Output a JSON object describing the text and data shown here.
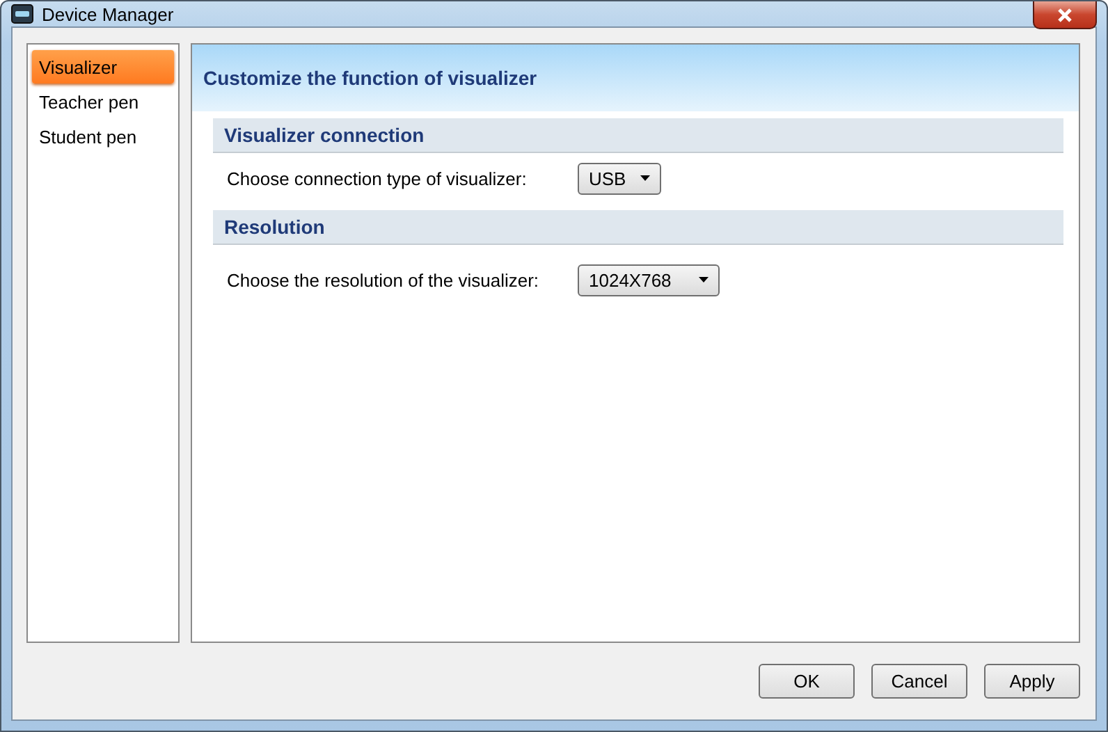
{
  "window": {
    "title": "Device Manager"
  },
  "sidebar": {
    "items": [
      {
        "label": "Visualizer",
        "selected": true
      },
      {
        "label": "Teacher pen",
        "selected": false
      },
      {
        "label": "Student pen",
        "selected": false
      }
    ]
  },
  "panel": {
    "title": "Customize the function of visualizer",
    "sections": [
      {
        "title": "Visualizer connection",
        "label": "Choose connection type of visualizer:",
        "value": "USB"
      },
      {
        "title": "Resolution",
        "label": "Choose the resolution of the visualizer:",
        "value": "1024X768"
      }
    ]
  },
  "buttons": [
    "OK",
    "Cancel",
    "Apply"
  ]
}
